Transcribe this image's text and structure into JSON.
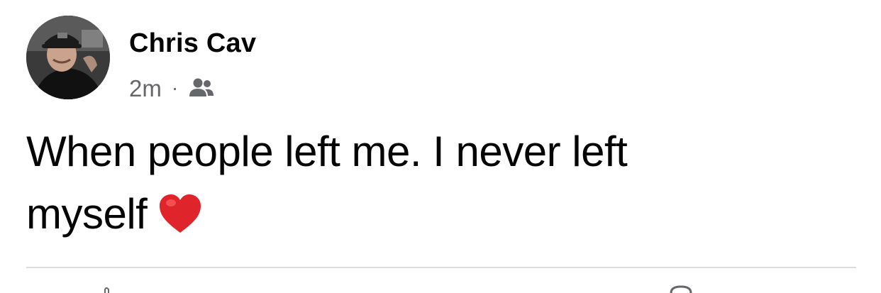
{
  "post": {
    "author": {
      "name": "Chris Cav",
      "avatar_icon": "profile-photo"
    },
    "meta": {
      "timestamp": "2m",
      "separator": "·",
      "audience_icon": "friends-icon"
    },
    "text": {
      "line1": "When people left me. I never left",
      "line2": "myself"
    },
    "emoji": "heart-icon",
    "colors": {
      "text": "#050505",
      "secondary": "#65676b",
      "heart": "#e0242b",
      "divider": "#dcdde1"
    }
  }
}
